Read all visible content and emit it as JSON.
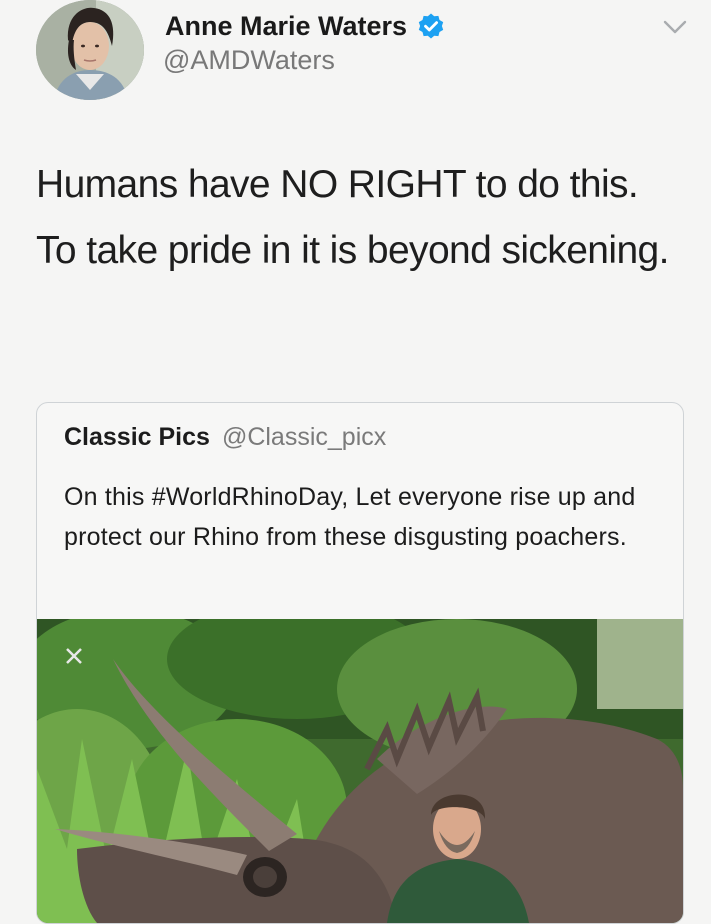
{
  "tweet": {
    "author_name": "Anne Marie Waters",
    "author_handle": "@AMDWaters",
    "text": "Humans have NO RIGHT to do this. To take pride in it is beyond sickening."
  },
  "quoted_tweet": {
    "author_name": "Classic Pics",
    "author_handle": "@Classic_picx",
    "text": "On this #WorldRhinoDay, Let everyone rise up and protect our Rhino from these disgusting poachers."
  },
  "icons": {
    "verified": "verified-badge-icon",
    "menu": "chevron-down-icon"
  },
  "colors": {
    "verified_blue": "#1da1f2",
    "handle_gray": "#787878",
    "card_border": "#cfd3d6"
  }
}
